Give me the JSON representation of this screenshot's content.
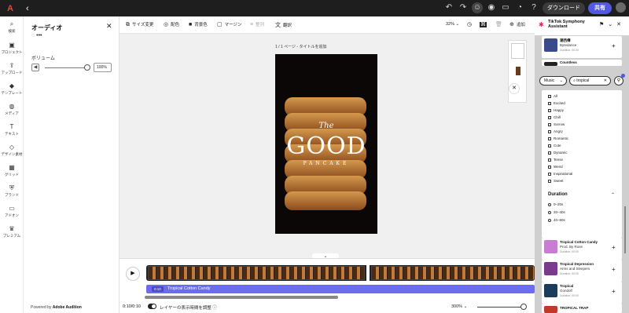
{
  "topbar": {
    "back": "‹",
    "download": "ダウンロード",
    "share": "共有"
  },
  "rail": [
    {
      "icon": "⌕",
      "label": "検索"
    },
    {
      "icon": "▣",
      "label": "プロジェクト"
    },
    {
      "icon": "⇪",
      "label": "アップロード"
    },
    {
      "icon": "◆",
      "label": "テンプレート"
    },
    {
      "icon": "◍",
      "label": "メディア"
    },
    {
      "icon": "T",
      "label": "テキスト"
    },
    {
      "icon": "◇",
      "label": "デザイン素材"
    },
    {
      "icon": "▦",
      "label": "グリッド"
    },
    {
      "icon": "⛨",
      "label": "ブランド"
    },
    {
      "icon": "▭",
      "label": "アドオン"
    },
    {
      "icon": "♛",
      "label": "プレミアム"
    }
  ],
  "panel": {
    "title": "オーディオ",
    "volume_label": "ボリューム",
    "volume_value": "100%",
    "powered_prefix": "Powered by ",
    "powered_brand": "Adobe Audition"
  },
  "toolbar": {
    "resize": "サイズ変更",
    "color": "配色",
    "bg": "背景色",
    "margin": "マージン",
    "arrange": "整列",
    "translate": "翻訳",
    "zoom": "32%",
    "add": "追加"
  },
  "canvas": {
    "page_label": "1 / 1 ページ - タイトルを追加",
    "poster_the": "The",
    "poster_good": "GOOD",
    "poster_pancake": "PANCAKE"
  },
  "timeline": {
    "audio_time": "0:10",
    "audio_name": "Tropical Cotton Candy",
    "time": "0:10/0:10",
    "caption": "レイヤーの表示時間を調整",
    "zoom": "300%"
  },
  "assistant": {
    "title": "TikTok Symphony Assistant"
  },
  "tracks_top": [
    {
      "name": "潮西傳",
      "artist": "Bytedance",
      "duration": "Duration: 00:30",
      "color": "#3a4a8a"
    },
    {
      "name": "Countless",
      "artist": "",
      "duration": "",
      "color": "#222"
    }
  ],
  "search": {
    "category": "Music",
    "query": "tropical"
  },
  "moods": [
    "All",
    "Excited",
    "Happy",
    "Chill",
    "Sorrow",
    "Angry",
    "Romantic",
    "Cute",
    "Dynamic",
    "Tense",
    "Weird",
    "Inspirational",
    "Sweet"
  ],
  "duration": {
    "title": "Duration",
    "options": [
      "0–20s",
      "20–40s",
      "40–60s"
    ]
  },
  "tracks_bottom": [
    {
      "name": "Tropical Cotton Candy",
      "artist": "Prod. By Rose",
      "duration": "Duration: 00:00",
      "color": "#c77dd1"
    },
    {
      "name": "Tropical Depression",
      "artist": "Arms and Sleepers",
      "duration": "Duration: 00:00",
      "color": "#7b3b8c"
    },
    {
      "name": "Tropical",
      "artist": "Gondolf",
      "duration": "Duration: 00:00",
      "color": "#1c3c5c"
    },
    {
      "name": "TROPICAL TRAP",
      "artist": "",
      "duration": "",
      "color": "#c0392b"
    }
  ],
  "colors": {
    "accent": "#5258e4",
    "audio_track": "#6b6cf0"
  }
}
